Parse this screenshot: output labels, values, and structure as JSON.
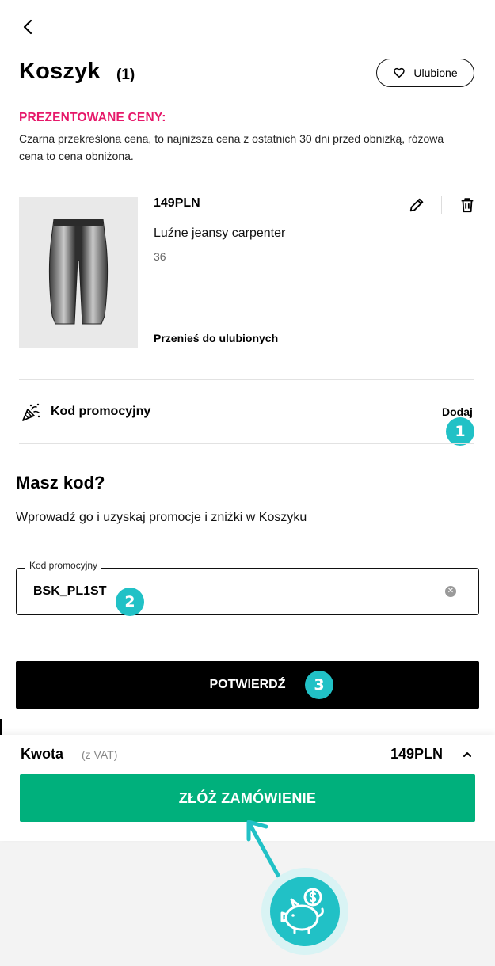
{
  "header": {
    "title": "Koszyk",
    "count": "(1)",
    "favorites_label": "Ulubione"
  },
  "prices_info": {
    "title": "PREZENTOWANE CENY:",
    "text": "Czarna przekreślona cena, to najniższa cena z ostatnich 30 dni przed obniżką, różowa cena to cena obniżona."
  },
  "product": {
    "price": "149PLN",
    "name": "Luźne jeansy carpenter",
    "size": "36",
    "move_to_favorites": "Przenieś do ulubionych"
  },
  "promo": {
    "label": "Kod promocyjny",
    "add_label": "Dodaj"
  },
  "code_form": {
    "title": "Masz kod?",
    "subtitle": "Wprowadź go i uzyskaj promocje i zniżki w Koszyku",
    "field_label": "Kod promocyjny",
    "field_value": "BSK_PL1ST",
    "confirm_label": "POTWIERDŹ"
  },
  "summary": {
    "amount_label": "Kwota",
    "vat_label": "(z VAT)",
    "amount_value": "149PLN",
    "order_label": "ZŁÓŻ ZAMÓWIENIE"
  },
  "steps": [
    "1",
    "2",
    "3"
  ],
  "icons": [
    "back-arrow-icon",
    "heart-icon",
    "pencil-icon",
    "trash-icon",
    "party-popper-icon",
    "clear-icon",
    "chevron-up-icon",
    "piggy-bank-icon",
    "arrow-icon"
  ],
  "colors": {
    "accent_pink": "#e6186a",
    "order_green": "#00b07c",
    "step_teal": "#21c1c6",
    "confirm_black": "#000000"
  }
}
